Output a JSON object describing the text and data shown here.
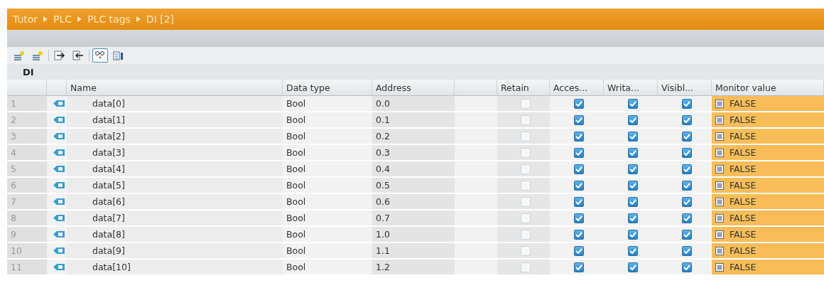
{
  "breadcrumb": [
    "Tutor",
    "PLC",
    "PLC tags",
    "DI [2]"
  ],
  "toolbar": [
    {
      "kind": "add-row",
      "on": false
    },
    {
      "kind": "insert-row",
      "on": false
    },
    {
      "kind": "export",
      "on": false
    },
    {
      "kind": "import",
      "on": false
    },
    {
      "kind": "monitor",
      "on": true
    },
    {
      "kind": "properties",
      "on": false
    }
  ],
  "table_title": "DI",
  "columns": [
    "Name",
    "Data type",
    "Address",
    "Retain",
    "Acces...",
    "Writa...",
    "Visibl...",
    "Monitor value"
  ],
  "rows": [
    {
      "number": "1",
      "name": "data[0]",
      "data_type": "Bool",
      "address": "0.0",
      "retain": false,
      "accessible": true,
      "writable": true,
      "visible": true,
      "monitor_value": "FALSE"
    },
    {
      "number": "2",
      "name": "data[1]",
      "data_type": "Bool",
      "address": "0.1",
      "retain": false,
      "accessible": true,
      "writable": true,
      "visible": true,
      "monitor_value": "FALSE"
    },
    {
      "number": "3",
      "name": "data[2]",
      "data_type": "Bool",
      "address": "0.2",
      "retain": false,
      "accessible": true,
      "writable": true,
      "visible": true,
      "monitor_value": "FALSE"
    },
    {
      "number": "4",
      "name": "data[3]",
      "data_type": "Bool",
      "address": "0.3",
      "retain": false,
      "accessible": true,
      "writable": true,
      "visible": true,
      "monitor_value": "FALSE"
    },
    {
      "number": "5",
      "name": "data[4]",
      "data_type": "Bool",
      "address": "0.4",
      "retain": false,
      "accessible": true,
      "writable": true,
      "visible": true,
      "monitor_value": "FALSE"
    },
    {
      "number": "6",
      "name": "data[5]",
      "data_type": "Bool",
      "address": "0.5",
      "retain": false,
      "accessible": true,
      "writable": true,
      "visible": true,
      "monitor_value": "FALSE"
    },
    {
      "number": "7",
      "name": "data[6]",
      "data_type": "Bool",
      "address": "0.6",
      "retain": false,
      "accessible": true,
      "writable": true,
      "visible": true,
      "monitor_value": "FALSE"
    },
    {
      "number": "8",
      "name": "data[7]",
      "data_type": "Bool",
      "address": "0.7",
      "retain": false,
      "accessible": true,
      "writable": true,
      "visible": true,
      "monitor_value": "FALSE"
    },
    {
      "number": "9",
      "name": "data[8]",
      "data_type": "Bool",
      "address": "1.0",
      "retain": false,
      "accessible": true,
      "writable": true,
      "visible": true,
      "monitor_value": "FALSE"
    },
    {
      "number": "10",
      "name": "data[9]",
      "data_type": "Bool",
      "address": "1.1",
      "retain": false,
      "accessible": true,
      "writable": true,
      "visible": true,
      "monitor_value": "FALSE"
    },
    {
      "number": "11",
      "name": "data[10]",
      "data_type": "Bool",
      "address": "1.2",
      "retain": false,
      "accessible": true,
      "writable": true,
      "visible": true,
      "monitor_value": "FALSE"
    }
  ]
}
